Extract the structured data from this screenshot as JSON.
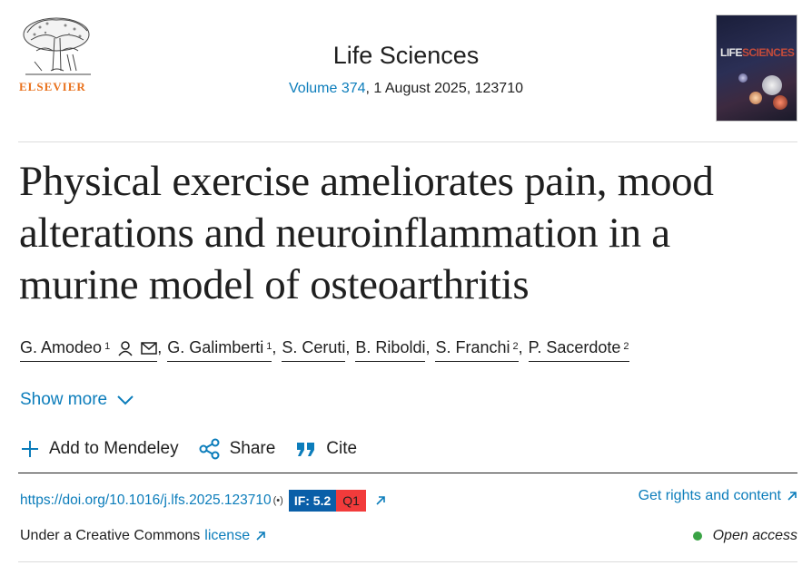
{
  "header": {
    "publisher": "ELSEVIER",
    "journal": "Life Sciences",
    "volume_link": "Volume 374",
    "volume_rest": ", 1 August 2025, 123710",
    "cover_title_a": "LIFE",
    "cover_title_b": "SCIENCES"
  },
  "article": {
    "title": "Physical exercise ameliorates pain, mood alterations and neuroinflammation in a murine model of osteoarthritis"
  },
  "authors": [
    {
      "name": "G. Amodeo",
      "sup": "1"
    },
    {
      "name": "G. Galimberti",
      "sup": "1"
    },
    {
      "name": "S. Ceruti",
      "sup": ""
    },
    {
      "name": "B. Riboldi",
      "sup": ""
    },
    {
      "name": "S. Franchi",
      "sup": "2"
    },
    {
      "name": "P. Sacerdote",
      "sup": "2"
    }
  ],
  "show_more": "Show more",
  "actions": {
    "mendeley": "Add to Mendeley",
    "share": "Share",
    "cite": "Cite"
  },
  "doi": {
    "url": "https://doi.org/10.1016/j.lfs.2025.123710",
    "broadcast": "(•)",
    "impact_factor": "IF: 5.2",
    "quartile": "Q1"
  },
  "rights_link": "Get rights and content",
  "license": {
    "prefix": "Under a Creative Commons",
    "link": "license"
  },
  "open_access": "Open access",
  "colors": {
    "link": "#0c7dbb",
    "publisher_orange": "#e9711c",
    "if_badge": "#0a5fa8",
    "q_badge": "#f23b3b",
    "oa_dot": "#3aa345"
  }
}
